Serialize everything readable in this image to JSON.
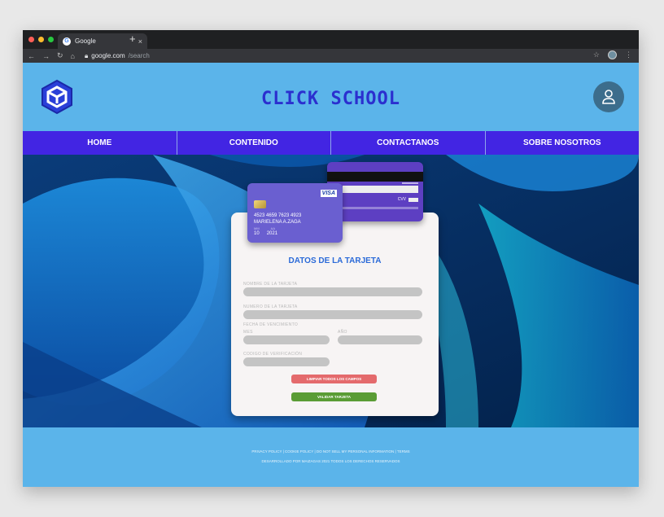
{
  "browser": {
    "tab_title": "Google",
    "tab_close": "×",
    "new_tab": "+",
    "url_host": "google.com",
    "url_path": "/search"
  },
  "site": {
    "title": "CLICK SCHOOL"
  },
  "nav": {
    "items": [
      "HOME",
      "CONTENIDO",
      "CONTACTANOS",
      "SOBRE NOSOTROS"
    ]
  },
  "card_front": {
    "brand": "VISA",
    "number": "4523 4659 7623 4923",
    "holder": "MARIELENA A.ZAGA",
    "month_label": "MM",
    "year_label": "AA",
    "month": "10",
    "year": "2021"
  },
  "card_back": {
    "cvv_label": "CVV"
  },
  "form": {
    "title": "DATOS DE LA TARJETA",
    "holder_label": "NOMBRE DE LA TARJETA",
    "number_label": "NUMERO DE LA TARJETA",
    "expiry_label": "FECHA DE VENCIMIENTO",
    "month_label": "MES",
    "year_label": "AÑO",
    "cvv_label": "CODIGO DE VERIFICACIÓN",
    "clear_button": "LIMPIAR TODOS LOS CAMPOS",
    "validate_button": "VALIDAR TARJETA"
  },
  "footer": {
    "links": "PRIVACY POLICY | COOKIE POLICY | DO NOT SELL MY PERSONAL INFORMATION | TERMS",
    "credits": "DESARROLLADO POR MAIZAGAS 2021 TODOS LOS DERECHOS RESERVADOS"
  },
  "colors": {
    "site_bg": "#5bb4ea",
    "nav_bg": "#4225e3",
    "title": "#2b2fcf",
    "clear_button": "#e46a6c",
    "validate_button": "#5a9c35"
  }
}
